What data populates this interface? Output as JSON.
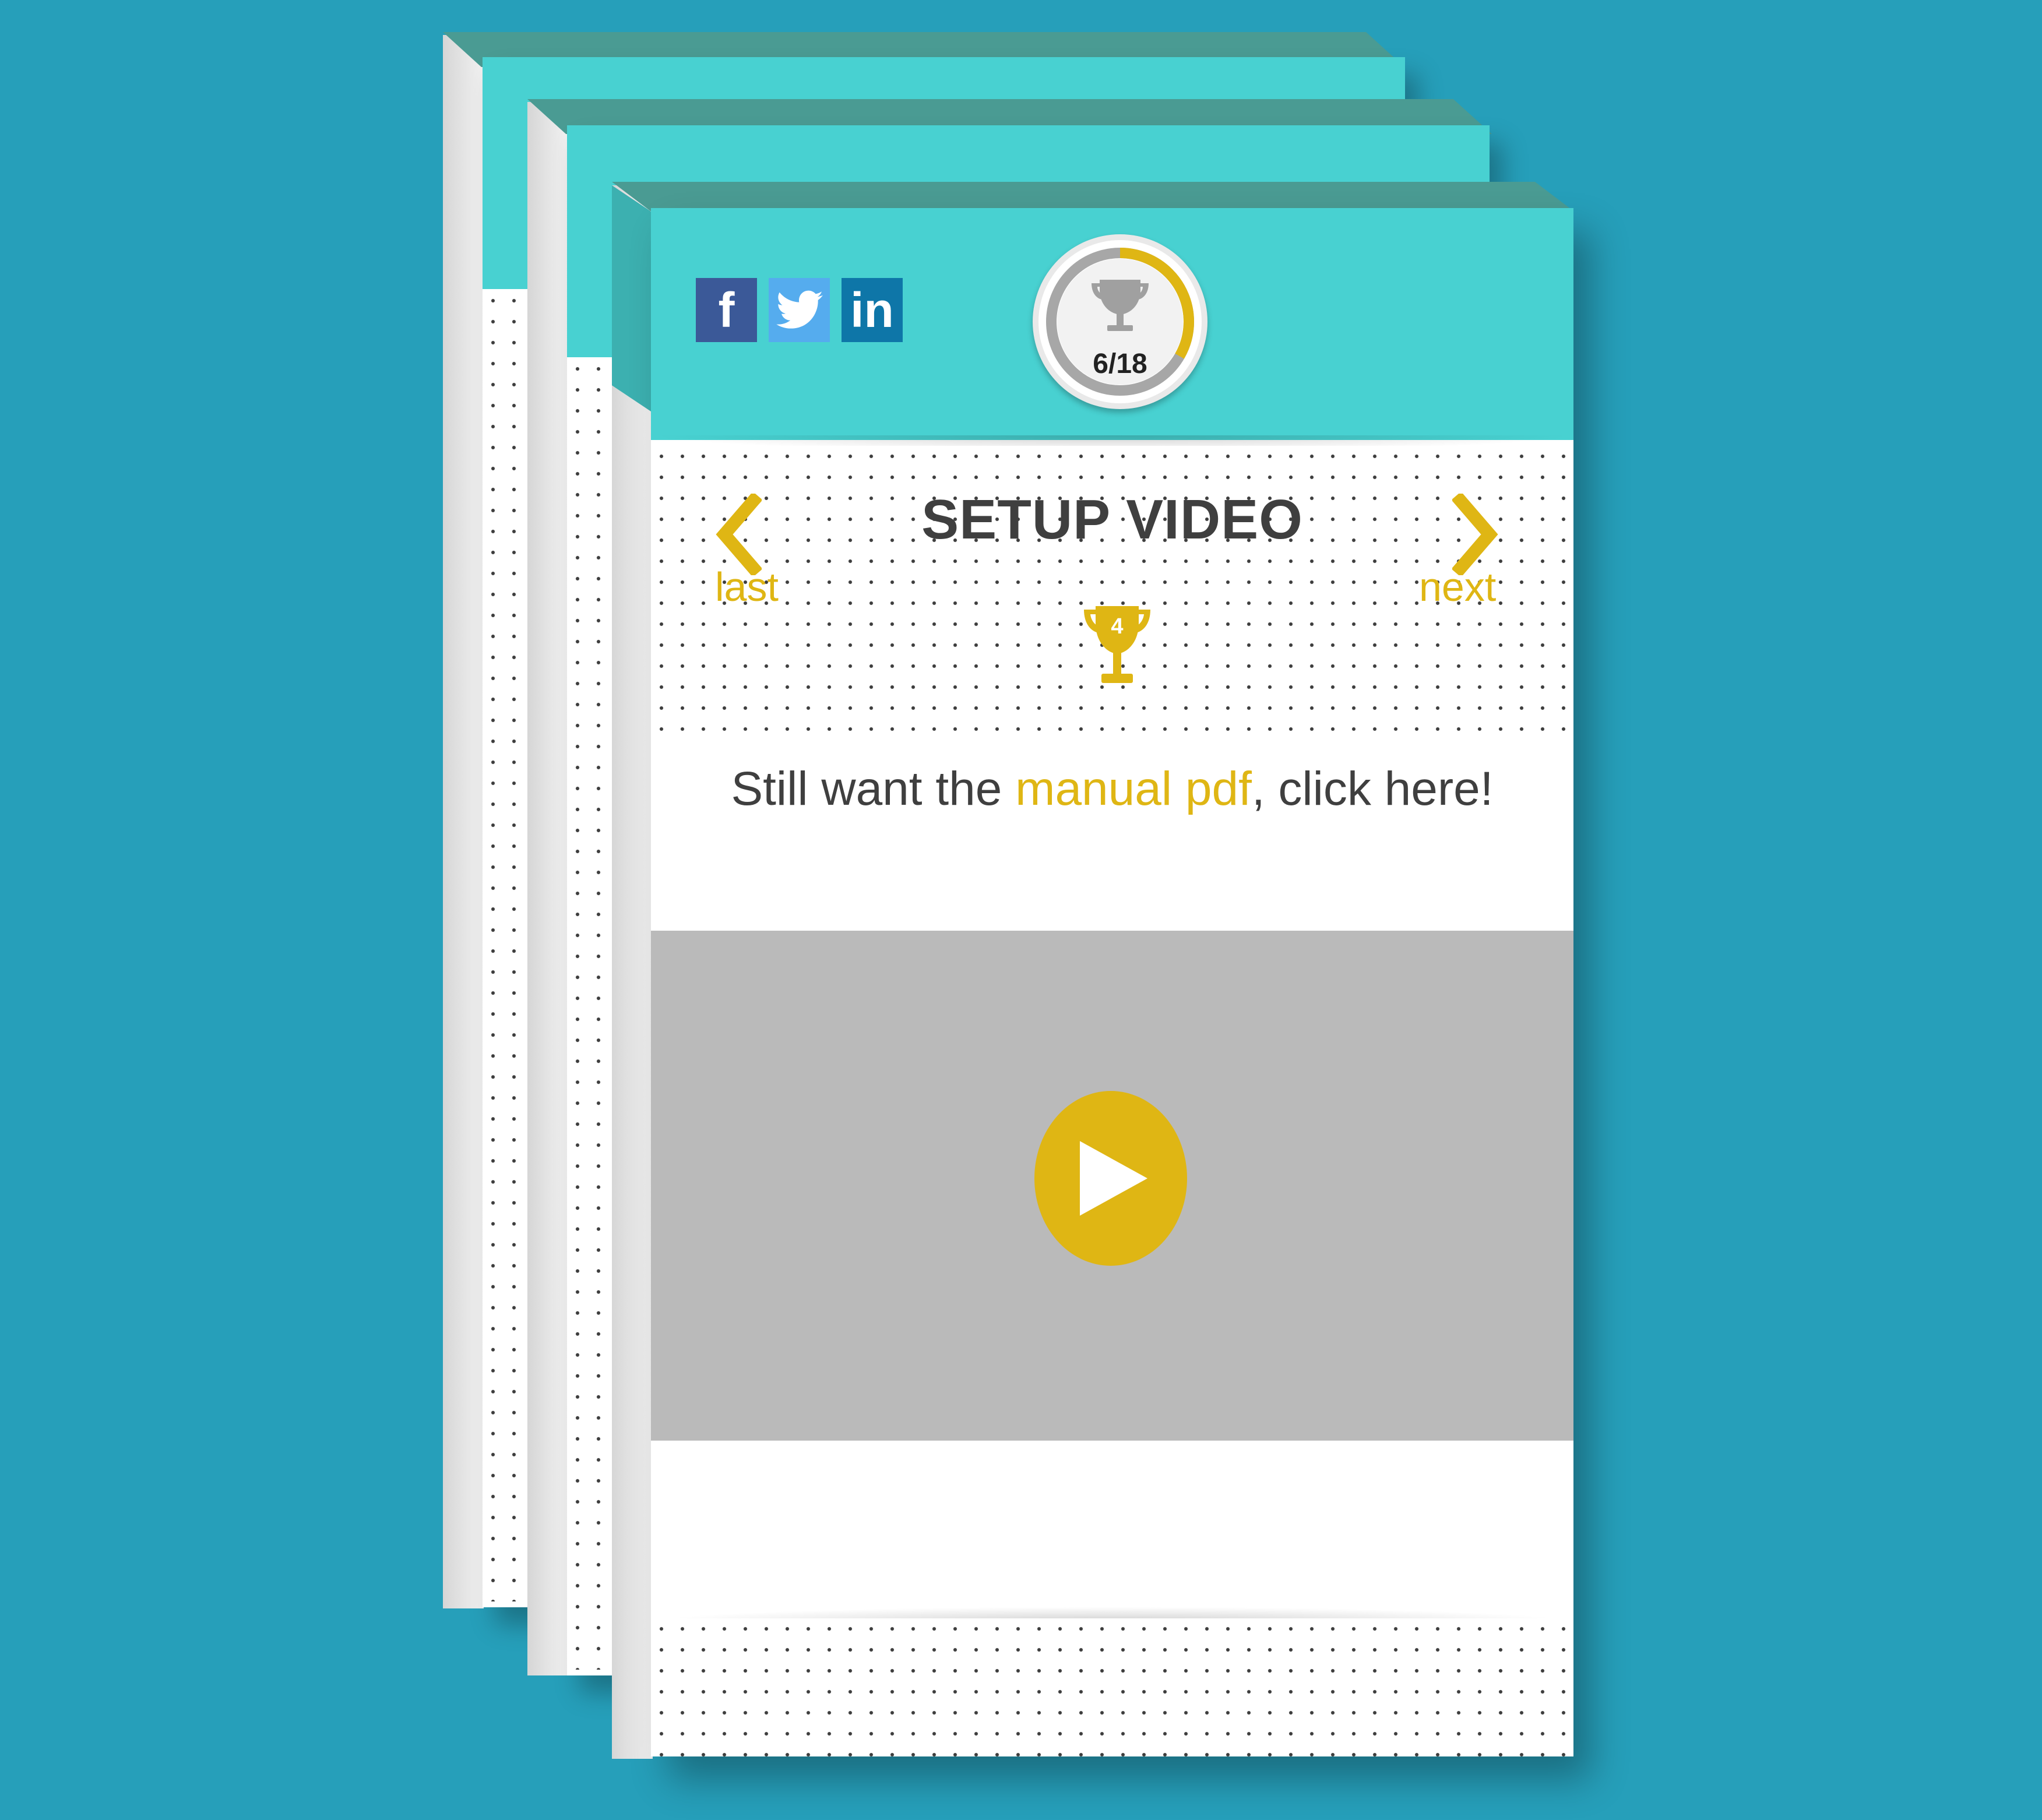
{
  "header": {
    "social": [
      {
        "name": "facebook",
        "glyph": "f"
      },
      {
        "name": "twitter",
        "glyph": "🐦"
      },
      {
        "name": "linkedin",
        "glyph": "in"
      }
    ],
    "progress": {
      "count_label": "6/18",
      "completed": 6,
      "total": 18
    }
  },
  "main": {
    "title": "SETUP VIDEO",
    "prev_label": "last",
    "next_label": "next",
    "trophy_points": "4",
    "pdf_prefix": "Still want the ",
    "pdf_link": "manual pdf",
    "pdf_suffix": ", click here!"
  },
  "colors": {
    "background": "#269fba",
    "header": "#48d1d1",
    "accent": "#dfb614",
    "video_bg": "#bababa",
    "text": "#3f3f3f"
  },
  "icons": {
    "prev": "chevron-left-icon",
    "next": "chevron-right-icon",
    "trophy": "trophy-icon",
    "play": "play-icon"
  }
}
